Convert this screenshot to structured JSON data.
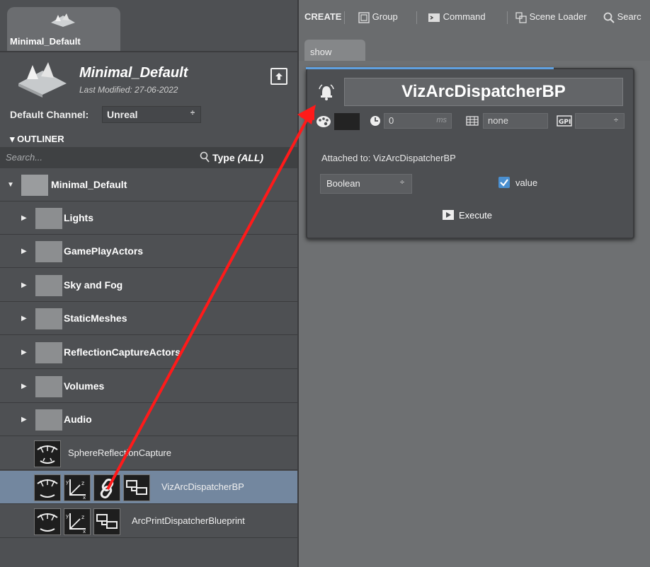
{
  "scene_tab": {
    "title": "Minimal_Default"
  },
  "scene_info": {
    "name": "Minimal_Default",
    "last_modified": "Last Modified: 27-06-2022"
  },
  "channel": {
    "label": "Default Channel:",
    "value": "Unreal"
  },
  "outliner": {
    "heading": "OUTLINER",
    "search_placeholder": "Search...",
    "type_label": "Type",
    "type_value": "(ALL)",
    "root": "Minimal_Default",
    "folders": [
      "Lights",
      "GamePlayActors",
      "Sky and Fog",
      "StaticMeshes",
      "ReflectionCaptureActors",
      "Volumes",
      "Audio"
    ],
    "actors": [
      "SphereReflectionCapture",
      "VizArcDispatcherBP",
      "ArcPrintDispatcherBlueprint"
    ]
  },
  "toolbar": {
    "create": "CREATE",
    "group": "Group",
    "command": "Command",
    "scene_loader": "Scene Loader",
    "search": "Searc"
  },
  "show_tab": "show",
  "dispatcher": {
    "title": "VizArcDispatcherBP",
    "delay_value": "0",
    "delay_unit": "ms",
    "gpi_text": "none",
    "attached_to": "Attached to: VizArcDispatcherBP",
    "type_value": "Boolean",
    "value_label": "value",
    "value_checked": true,
    "execute_label": "Execute"
  },
  "colors": {
    "accent": "#4a8fd0",
    "selected_row": "#73879f",
    "arrow": "#ff1a1a"
  }
}
